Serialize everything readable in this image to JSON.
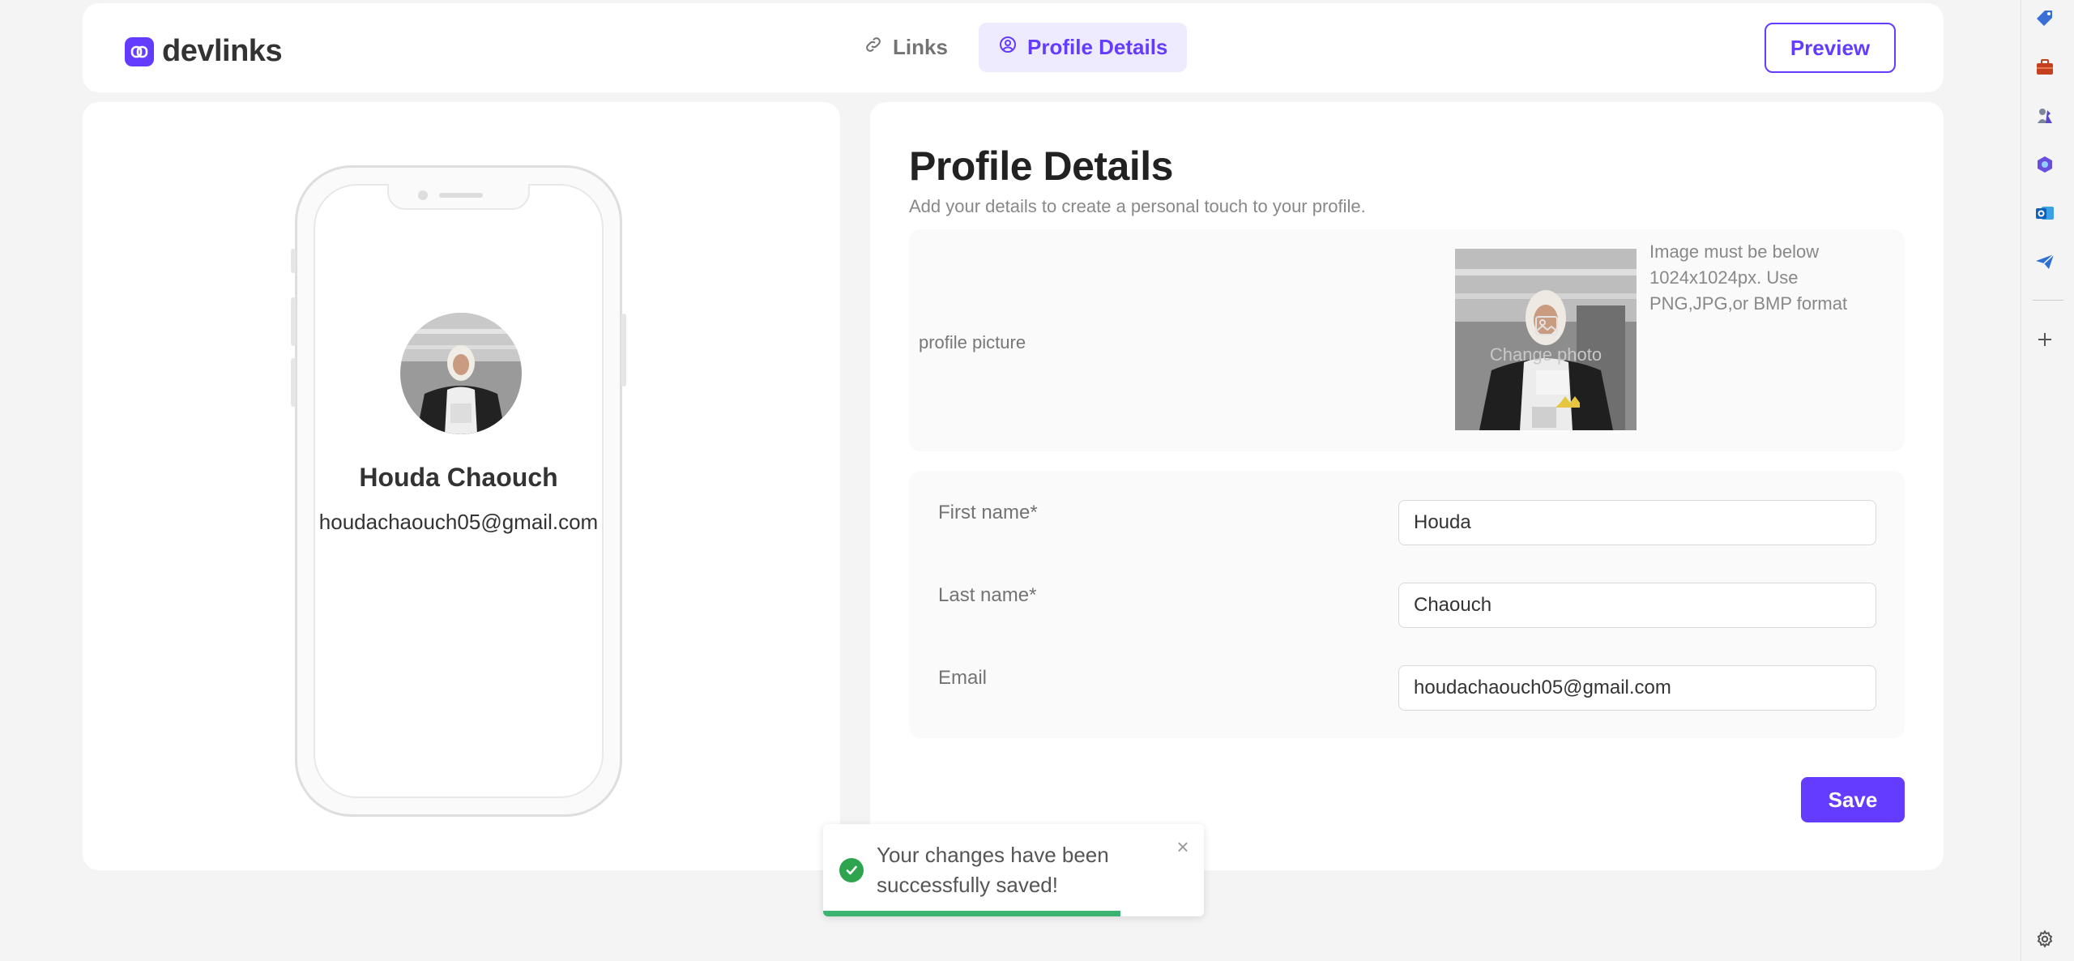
{
  "app": {
    "brand": "devlinks",
    "accent_color": "#633cff"
  },
  "nav": {
    "tabs": [
      {
        "label": "Links",
        "icon": "link-icon",
        "active": false
      },
      {
        "label": "Profile Details",
        "icon": "user-circle-icon",
        "active": true
      }
    ],
    "preview_label": "Preview"
  },
  "phone_preview": {
    "name": "Houda Chaouch",
    "email": "houdachaouch05@gmail.com"
  },
  "profile": {
    "title": "Profile Details",
    "subtitle": "Add your details to create a personal touch to your profile.",
    "picture_label": "profile picture",
    "change_photo_label": "Change photo",
    "picture_hint": "Image must be below 1024x1024px. Use PNG,JPG,or BMP format",
    "fields": {
      "first_name": {
        "label": "First name*",
        "value": "Houda"
      },
      "last_name": {
        "label": "Last name*",
        "value": "Chaouch"
      },
      "email": {
        "label": "Email",
        "value": "houdachaouch05@gmail.com"
      }
    },
    "save_label": "Save"
  },
  "toast": {
    "message": "Your changes have been successfully saved!",
    "progress": 0.78,
    "success_color": "#2ea44f"
  },
  "edge_sidebar": {
    "icons": [
      "tag-icon",
      "briefcase-icon",
      "chess-icon",
      "copilot-icon",
      "outlook-icon",
      "send-icon",
      "plus-icon",
      "settings-icon"
    ]
  }
}
